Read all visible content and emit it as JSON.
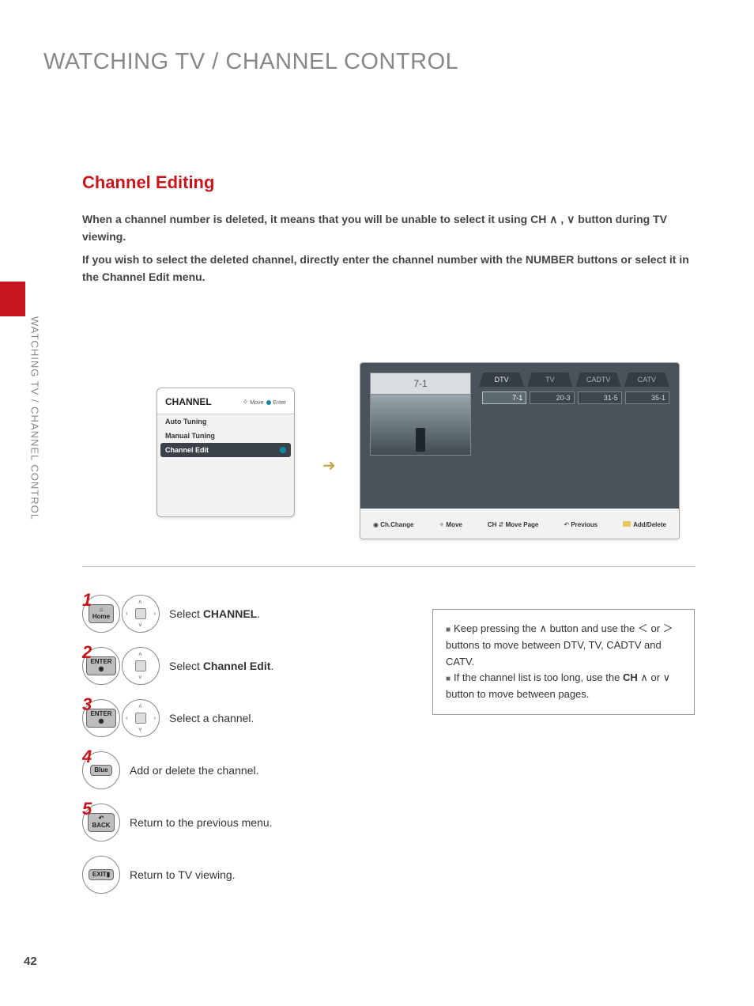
{
  "page": {
    "title": "WATCHING TV / CHANNEL CONTROL",
    "sidebar": "WATCHING TV / CHANNEL CONTROL",
    "number": "42"
  },
  "section": {
    "heading": "Channel Editing",
    "paragraph1": "When a channel number is deleted, it means that you will be unable to select it using CH ∧ , ∨ button during TV viewing.",
    "paragraph2": "If you wish to select the deleted channel, directly enter the channel number with the NUMBER buttons or select it in the Channel Edit menu."
  },
  "osd_menu": {
    "title": "CHANNEL",
    "hint_move": "Move",
    "hint_enter": "Enter",
    "items": [
      "Auto Tuning",
      "Manual Tuning",
      "Channel Edit"
    ]
  },
  "osd_edit": {
    "current_channel": "7-1",
    "tabs": [
      "DTV",
      "TV",
      "CADTV",
      "CATV"
    ],
    "channels": [
      "7-1",
      "20-3",
      "31-5",
      "35-1"
    ],
    "footer": {
      "chchange": "Ch.Change",
      "move": "Move",
      "movepage": "Move Page",
      "movepage_prefix": "CH",
      "previous": "Previous",
      "adddelete": "Add/Delete"
    }
  },
  "steps": [
    {
      "num": "1",
      "button": "Home",
      "nav": true,
      "text_prefix": "Select ",
      "text_bold": "CHANNEL",
      "text_suffix": "."
    },
    {
      "num": "2",
      "button": "ENTER\n◉",
      "nav": true,
      "text_prefix": "Select ",
      "text_bold": "Channel Edit",
      "text_suffix": "."
    },
    {
      "num": "3",
      "button": "ENTER\n◉",
      "nav": true,
      "text_prefix": "Select a channel.",
      "text_bold": "",
      "text_suffix": ""
    },
    {
      "num": "4",
      "button": "Blue",
      "nav": false,
      "text_prefix": "Add or delete the channel.",
      "text_bold": "",
      "text_suffix": ""
    },
    {
      "num": "5",
      "button": "BACK",
      "nav": false,
      "text_prefix": "Return to the previous menu.",
      "text_bold": "",
      "text_suffix": ""
    },
    {
      "num": "",
      "button": "EXIT▮",
      "nav": false,
      "text_prefix": "Return to TV viewing.",
      "text_bold": "",
      "text_suffix": ""
    }
  ],
  "tips": {
    "tip1": "Keep pressing the ∧ button and use the ＜ or ＞ buttons to move between DTV, TV, CADTV and CATV.",
    "tip2_prefix": "If the channel list is too long, use the ",
    "tip2_bold": "CH",
    "tip2_suffix": " ∧ or ∨ button to move between pages."
  }
}
